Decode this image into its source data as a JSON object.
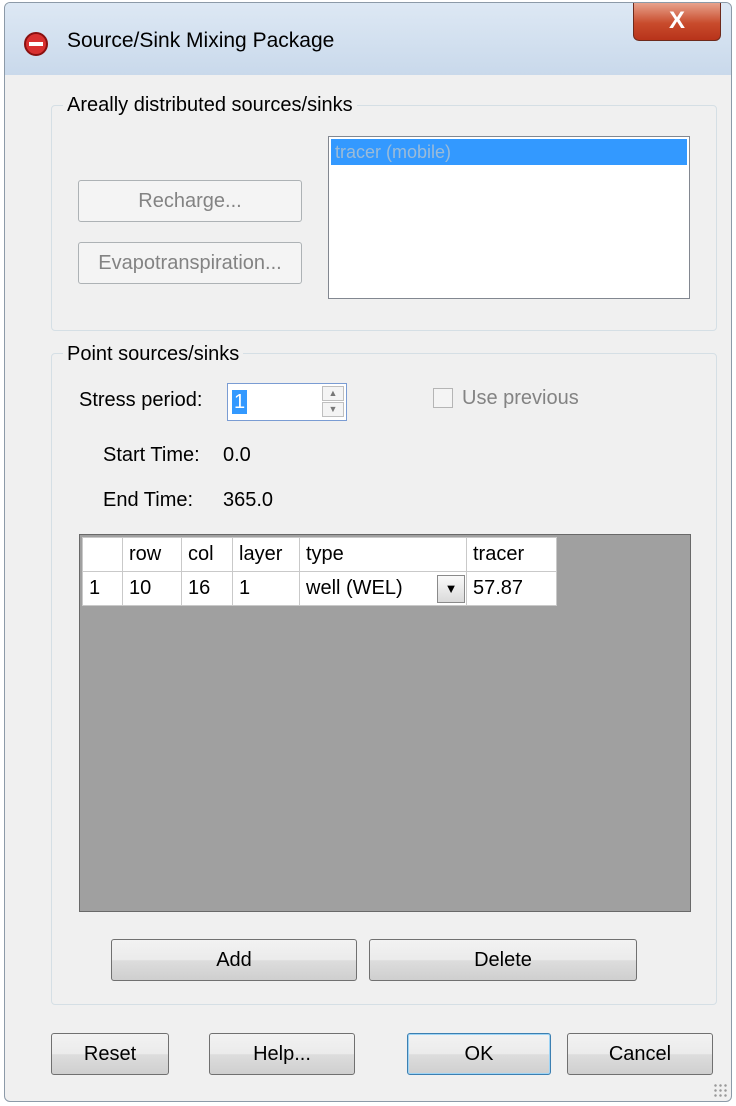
{
  "window": {
    "title": "Source/Sink Mixing Package",
    "close_label": "X"
  },
  "areal": {
    "group_title": "Areally distributed sources/sinks",
    "recharge_label": "Recharge...",
    "evapo_label": "Evapotranspiration...",
    "species": [
      "tracer (mobile)"
    ]
  },
  "point": {
    "group_title": "Point sources/sinks",
    "stress_period_label": "Stress period:",
    "stress_period_value": "1",
    "use_previous_label": "Use previous",
    "use_previous_checked": false,
    "start_time_label": "Start Time:",
    "start_time_value": "0.0",
    "end_time_label": "End Time:",
    "end_time_value": "365.0",
    "table": {
      "headers": [
        "",
        "row",
        "col",
        "layer",
        "type",
        "tracer"
      ],
      "rows": [
        {
          "num": "1",
          "row": "10",
          "col": "16",
          "layer": "1",
          "type": "well (WEL)",
          "tracer": "57.87"
        }
      ]
    },
    "add_label": "Add",
    "delete_label": "Delete"
  },
  "footer": {
    "reset_label": "Reset",
    "help_label": "Help...",
    "ok_label": "OK",
    "cancel_label": "Cancel"
  },
  "colors": {
    "selection": "#3399ff",
    "grid_background": "#a0a0a0",
    "close_button": "#c84b2c"
  }
}
